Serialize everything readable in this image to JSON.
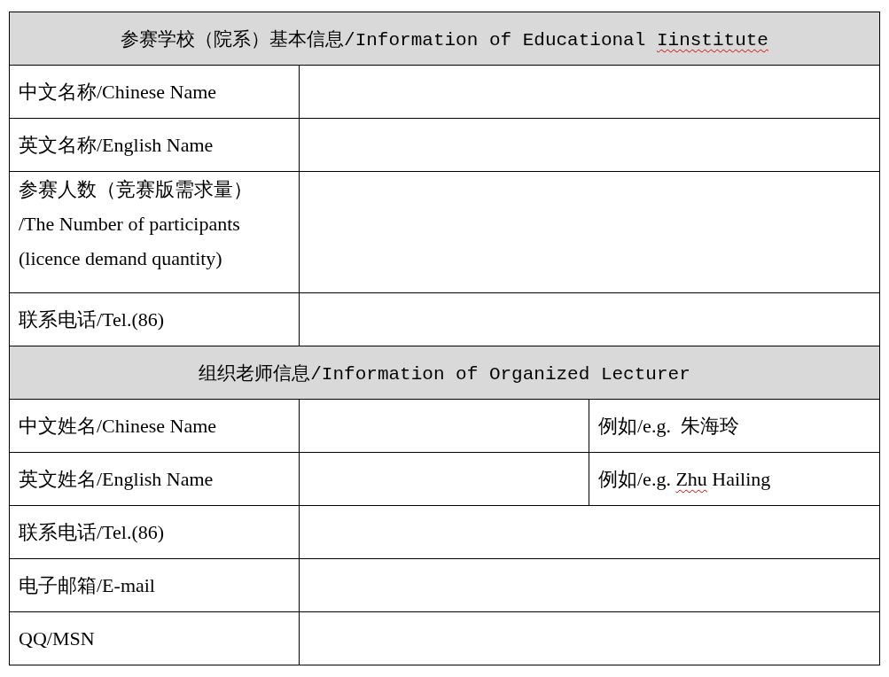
{
  "sections": [
    {
      "title": [
        {
          "text": "参赛学校（院系）基本信息/Information of Educational ",
          "misspelled": false
        },
        {
          "text": "Iinstitute",
          "misspelled": true
        }
      ],
      "rows": [
        {
          "kind": "single",
          "label": [
            "中文名称/Chinese Name"
          ]
        },
        {
          "kind": "single",
          "label": [
            "英文名称/English Name"
          ]
        },
        {
          "kind": "tall",
          "label": [
            "参赛人数（竞赛版需求量）",
            "/The Number of participants",
            "(licence demand quantity)"
          ]
        },
        {
          "kind": "single",
          "label": [
            "联系电话/Tel.(86)"
          ]
        }
      ]
    },
    {
      "title": [
        {
          "text": "组织老师信息/Information of Organized Lecturer",
          "misspelled": false
        }
      ],
      "rows": [
        {
          "kind": "split",
          "label": [
            "中文姓名/Chinese Name"
          ],
          "example": [
            {
              "text": "例如/e.g.  朱海玲",
              "misspelled": false
            }
          ]
        },
        {
          "kind": "split",
          "label": [
            "英文姓名/English Name"
          ],
          "example": [
            {
              "text": "例如/e.g. ",
              "misspelled": false
            },
            {
              "text": "Zhu",
              "misspelled": true
            },
            {
              "text": " Hailing",
              "misspelled": false
            }
          ]
        },
        {
          "kind": "single",
          "label": [
            "联系电话/Tel.(86)"
          ]
        },
        {
          "kind": "single",
          "label": [
            "电子邮箱/E-mail"
          ]
        },
        {
          "kind": "single",
          "label": [
            "QQ/MSN"
          ]
        }
      ]
    }
  ]
}
